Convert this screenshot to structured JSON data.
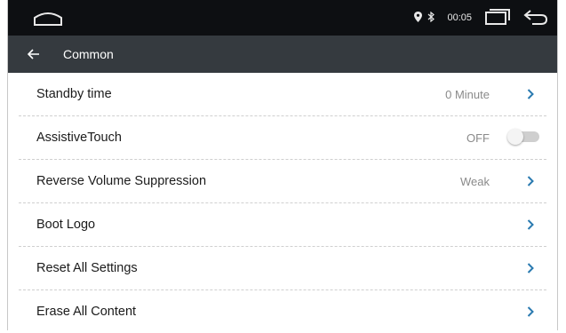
{
  "status_bar": {
    "time": "00:05",
    "icons": [
      "home-icon",
      "location-icon",
      "bluetooth-icon",
      "recent-apps-icon",
      "back-icon"
    ]
  },
  "title_bar": {
    "title": "Common"
  },
  "settings": [
    {
      "label": "Standby time",
      "value": "0 Minute",
      "control": "chevron-right-icon"
    },
    {
      "label": "AssistiveTouch",
      "value": "OFF",
      "control": "toggle-switch"
    },
    {
      "label": "Reverse Volume Suppression",
      "value": "Weak",
      "control": "chevron-right-icon"
    },
    {
      "label": "Boot Logo",
      "value": "",
      "control": "chevron-right-icon"
    },
    {
      "label": "Reset All Settings",
      "value": "",
      "control": "chevron-right-icon"
    },
    {
      "label": "Erase All Content",
      "value": "",
      "control": "chevron-right-icon"
    }
  ],
  "colors": {
    "status_bar_bg": "#0d0f12",
    "title_bar_bg": "#353a3f",
    "accent": "#2a7ab0"
  }
}
